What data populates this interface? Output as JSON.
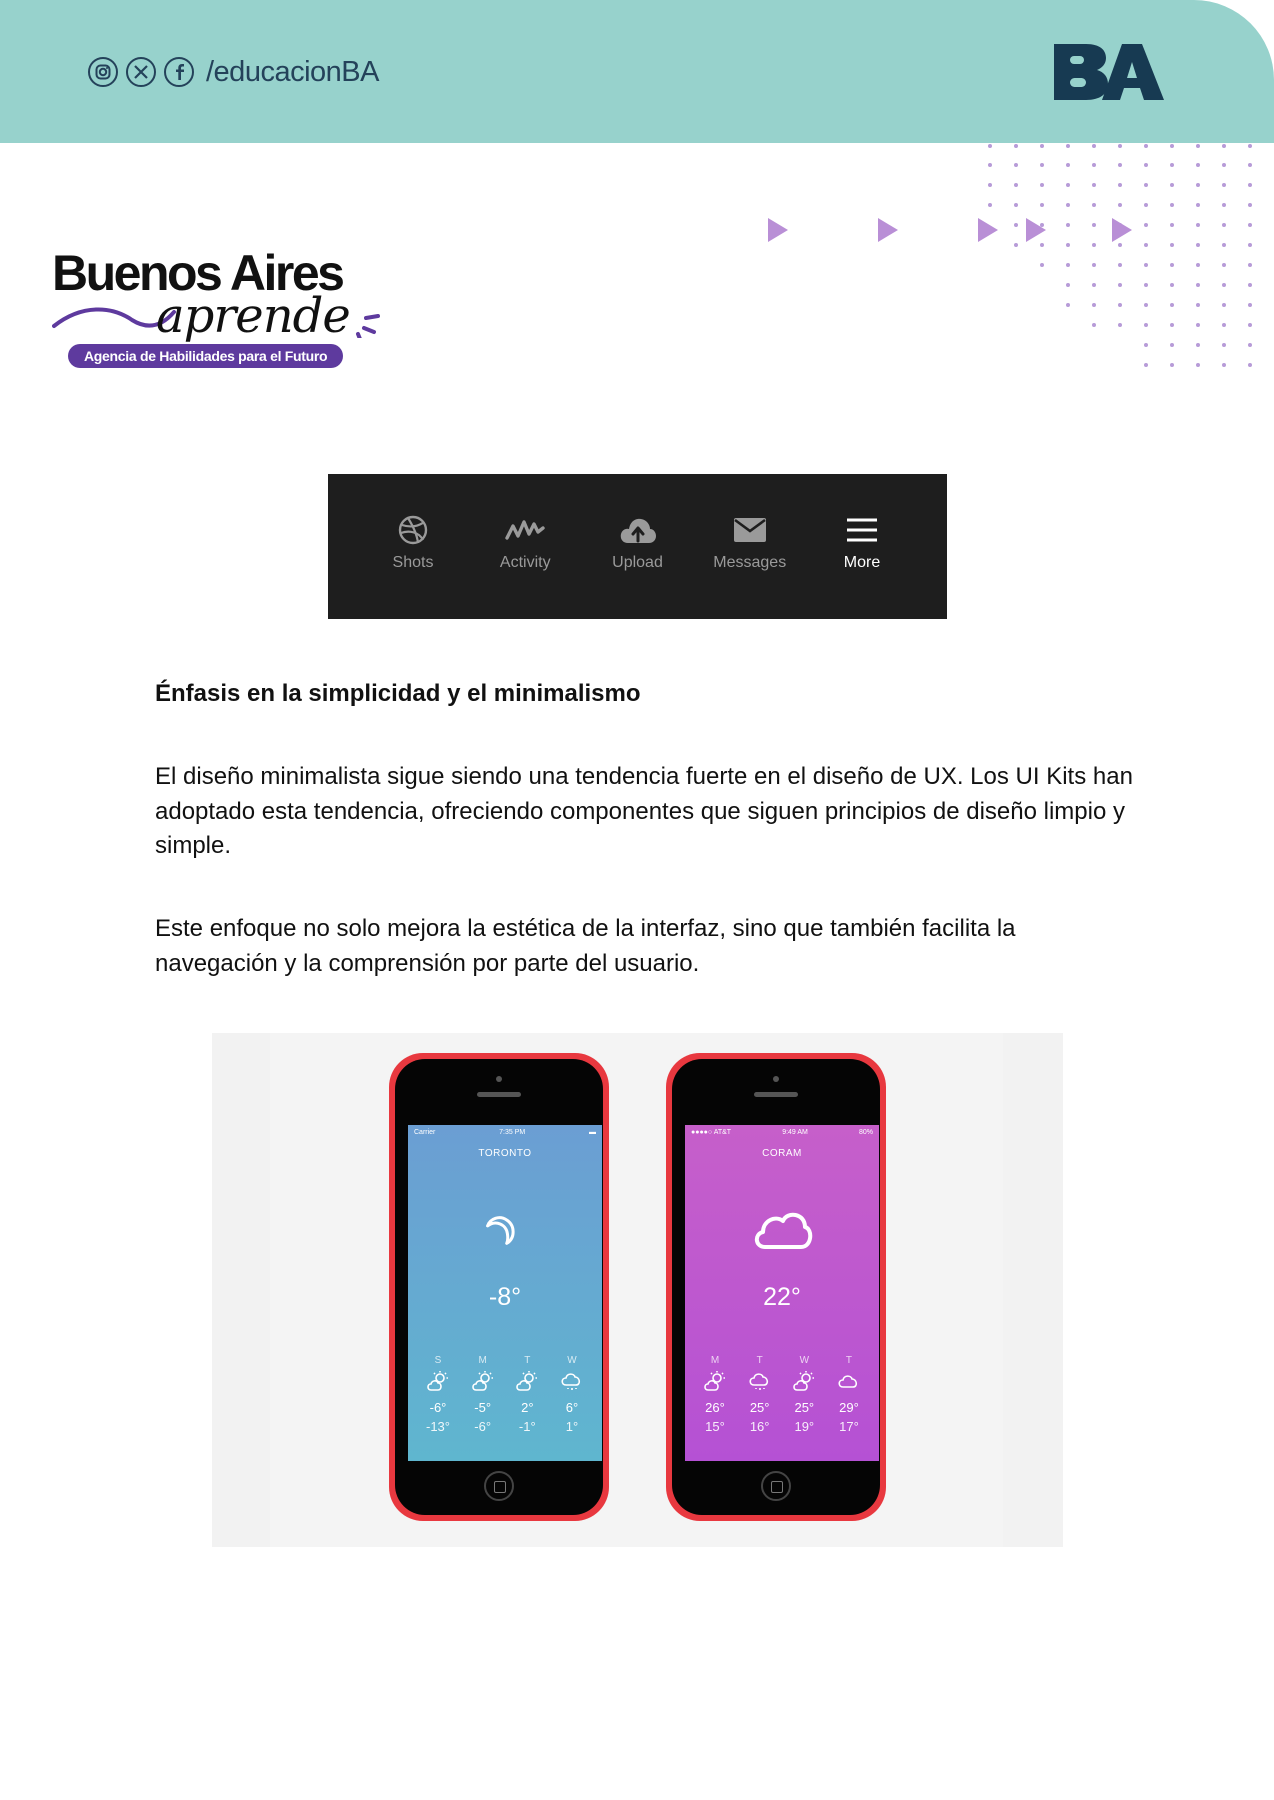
{
  "header": {
    "social_icons": [
      "instagram-icon",
      "x-icon",
      "facebook-icon"
    ],
    "handle": "/educacionBA",
    "logo_text": "BA",
    "colors": {
      "band": "#97d2cc",
      "logo": "#173a52"
    }
  },
  "brand": {
    "title": "Buenos Aires",
    "subtitle": "aprende",
    "tagline": "Agencia de Habilidades para el Futuro",
    "accent": "#5e3a9e"
  },
  "tabbar": {
    "items": [
      {
        "label": "Shots",
        "icon": "dribbble-icon"
      },
      {
        "label": "Activity",
        "icon": "activity-icon"
      },
      {
        "label": "Upload",
        "icon": "cloud-upload-icon"
      },
      {
        "label": "Messages",
        "icon": "envelope-icon"
      },
      {
        "label": "More",
        "icon": "menu-icon"
      }
    ],
    "active": "More"
  },
  "article": {
    "heading": "Énfasis en la simplicidad y el minimalismo",
    "paragraph1": "El diseño minimalista sigue siendo una tendencia fuerte en el diseño de UX. Los UI Kits han adoptado esta tendencia, ofreciendo componentes que siguen principios de diseño limpio y simple.",
    "paragraph2": "Este enfoque no solo mejora la estética de la interfaz, sino que también facilita la navegación y la comprensión por parte del usuario."
  },
  "phones": [
    {
      "carrier": "Carrier",
      "time": "7:35 PM",
      "city": "TORONTO",
      "current_icon": "moon-icon",
      "temp": "-8°",
      "forecast": [
        {
          "day": "S",
          "icon": "partly-cloudy-icon",
          "hi": "-6°",
          "lo": "-13°"
        },
        {
          "day": "M",
          "icon": "partly-cloudy-icon",
          "hi": "-5°",
          "lo": "-6°"
        },
        {
          "day": "T",
          "icon": "partly-cloudy-icon",
          "hi": "2°",
          "lo": "-1°"
        },
        {
          "day": "W",
          "icon": "rain-cloud-icon",
          "hi": "6°",
          "lo": "1°"
        }
      ]
    },
    {
      "carrier": "●●●●○ AT&T",
      "time": "9:49 AM",
      "battery": "80%",
      "city": "CORAM",
      "current_icon": "cloud-icon",
      "temp": "22°",
      "forecast": [
        {
          "day": "M",
          "icon": "partly-cloudy-icon",
          "hi": "26°",
          "lo": "15°"
        },
        {
          "day": "T",
          "icon": "rain-cloud-icon",
          "hi": "25°",
          "lo": "16°"
        },
        {
          "day": "W",
          "icon": "partly-cloudy-icon",
          "hi": "25°",
          "lo": "19°"
        },
        {
          "day": "T",
          "icon": "cloud-icon",
          "hi": "29°",
          "lo": "17°"
        }
      ]
    }
  ]
}
